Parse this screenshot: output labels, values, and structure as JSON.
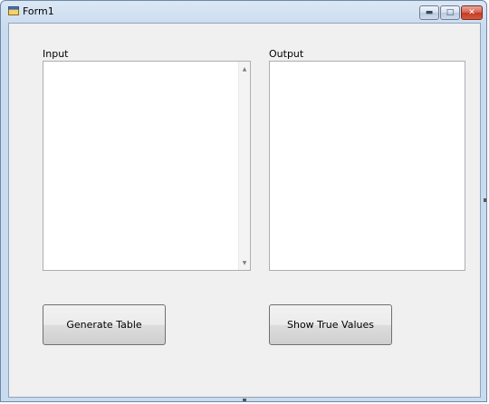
{
  "window": {
    "title": "Form1",
    "icon": "form-app-icon",
    "controls": {
      "minimize_glyph": "▬",
      "maximize_glyph": "□",
      "close_glyph": "✕"
    }
  },
  "form": {
    "input_label": "Input",
    "output_label": "Output",
    "input_value": "",
    "output_value": "",
    "input_scroll_up_glyph": "▲",
    "input_scroll_down_glyph": "▼",
    "generate_button_label": "Generate Table",
    "show_button_label": "Show True Values"
  },
  "colors": {
    "title_bar": "#c9dbee",
    "client_background": "#f0f0f0",
    "close_button": "#c43a24",
    "textbox_background": "#ffffff"
  }
}
